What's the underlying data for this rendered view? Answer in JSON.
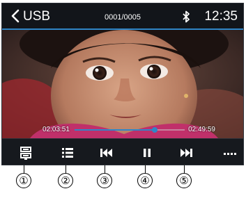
{
  "status_bar": {
    "source_label": "USB",
    "track_counter": "0001/0005",
    "time": "12:35",
    "accent_color": "#2f86c8"
  },
  "video": {
    "current_time": "02:03:51",
    "total_time": "02:49:59",
    "progress_fraction": 0.73
  },
  "controls": [
    {
      "name": "playback-mode-icon"
    },
    {
      "name": "playlist-icon"
    },
    {
      "name": "previous-track-icon"
    },
    {
      "name": "pause-icon"
    },
    {
      "name": "next-track-icon"
    },
    {
      "name": "more-options-icon"
    }
  ],
  "callouts": [
    "①",
    "②",
    "③",
    "④",
    "⑤"
  ]
}
